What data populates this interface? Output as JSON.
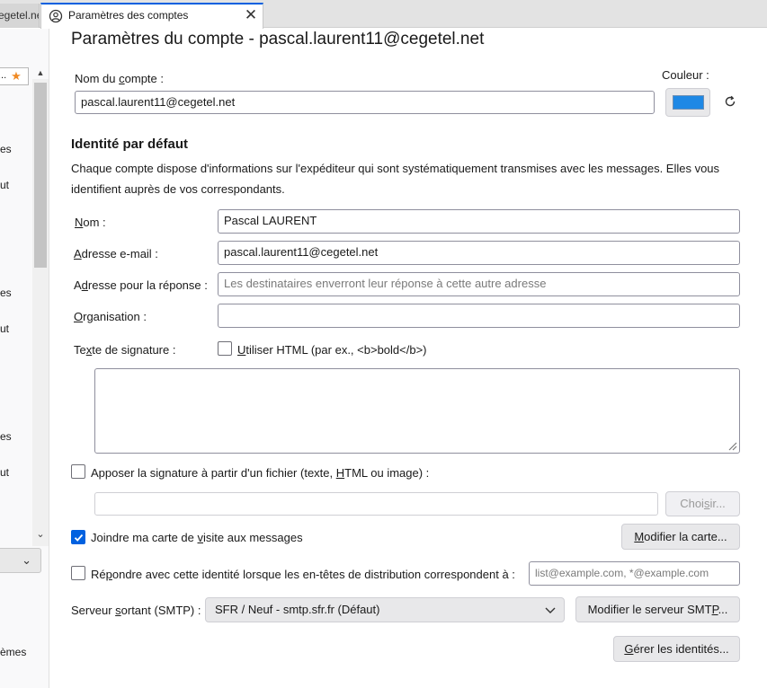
{
  "tabs": {
    "previous_tab_label": "cegetel.net",
    "active_tab_label": "Paramètres des comptes",
    "close_glyph": "✕"
  },
  "left_panel": {
    "input_text": "...",
    "star_glyph": "★",
    "fragments": [
      "es",
      "ut",
      "es",
      "ut",
      "es",
      "ut",
      "èmes"
    ],
    "dropdown_glyph": "⌄"
  },
  "page": {
    "title": "Paramètres du compte - pascal.laurent11@cegetel.net"
  },
  "account": {
    "name_label": "Nom du compte :",
    "name_value": "pascal.laurent11@cegetel.net",
    "color_label": "Couleur :",
    "color_value": "#1e88e5",
    "reset_glyph": "⟳"
  },
  "identity": {
    "section_title": "Identité par défaut",
    "description": "Chaque compte dispose d'informations sur l'expéditeur qui sont systématiquement transmises avec les messages. Elles vous identifient auprès de vos correspondants.",
    "name_label": "Nom :",
    "name_value": "Pascal LAURENT",
    "email_label": "Adresse e-mail :",
    "email_value": "pascal.laurent11@cegetel.net",
    "reply_label": "Adresse pour la réponse :",
    "reply_placeholder": "Les destinataires enverront leur réponse à cette autre adresse",
    "org_label": "Organisation :",
    "org_value": "",
    "signature_label": "Texte de signature :",
    "use_html_label": "Utiliser HTML (par ex., <b>bold</b>)",
    "use_html_checked": false,
    "signature_text": "",
    "attach_signature_label": "Apposer la signature à partir d'un fichier (texte, HTML ou image) :",
    "attach_signature_checked": false,
    "signature_file_value": "",
    "choose_button": "Choisir...",
    "vcard_label": "Joindre ma carte de visite aux messages",
    "vcard_checked": true,
    "edit_card_button": "Modifier la carte...",
    "reply_from_label": "Répondre avec cette identité lorsque les en-têtes de distribution correspondent à :",
    "reply_from_checked": false,
    "reply_from_placeholder": "list@example.com, *@example.com",
    "smtp_label": "Serveur sortant (SMTP) :",
    "smtp_value": "SFR / Neuf - smtp.sfr.fr (Défaut)",
    "edit_smtp_button": "Modifier le serveur SMTP...",
    "manage_identities_button": "Gérer les identités..."
  }
}
